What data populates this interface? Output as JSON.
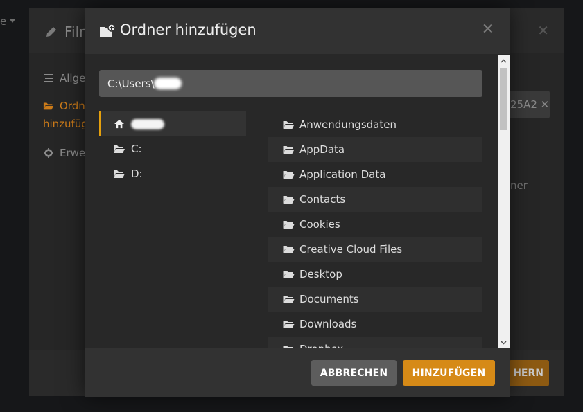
{
  "background": {
    "edge_text": "e",
    "dialog_title": "Filn",
    "nav": {
      "general": "Allge",
      "folder_line1": "Ordn",
      "folder_line2": "hinzufüg",
      "advanced": "Erwe"
    },
    "right_field_text": "25A2",
    "right_text": "ner",
    "save_label": "HERN"
  },
  "modal": {
    "title": "Ordner hinzufügen",
    "close_symbol": "✕",
    "path_value": "C:\\Users\\",
    "drives": [
      {
        "label": "",
        "icon": "home-icon",
        "selected": true
      },
      {
        "label": "C:",
        "icon": "folder-icon",
        "selected": false
      },
      {
        "label": "D:",
        "icon": "folder-icon",
        "selected": false
      }
    ],
    "folders": [
      "Anwendungsdaten",
      "AppData",
      "Application Data",
      "Contacts",
      "Cookies",
      "Creative Cloud Files",
      "Desktop",
      "Documents",
      "Downloads",
      "Dropbox"
    ],
    "buttons": {
      "cancel": "ABBRECHEN",
      "add": "HINZUFÜGEN"
    }
  },
  "colors": {
    "accent": "#e5a00d",
    "add_button": "#d68a17",
    "cancel_button": "#5d5d5d"
  }
}
